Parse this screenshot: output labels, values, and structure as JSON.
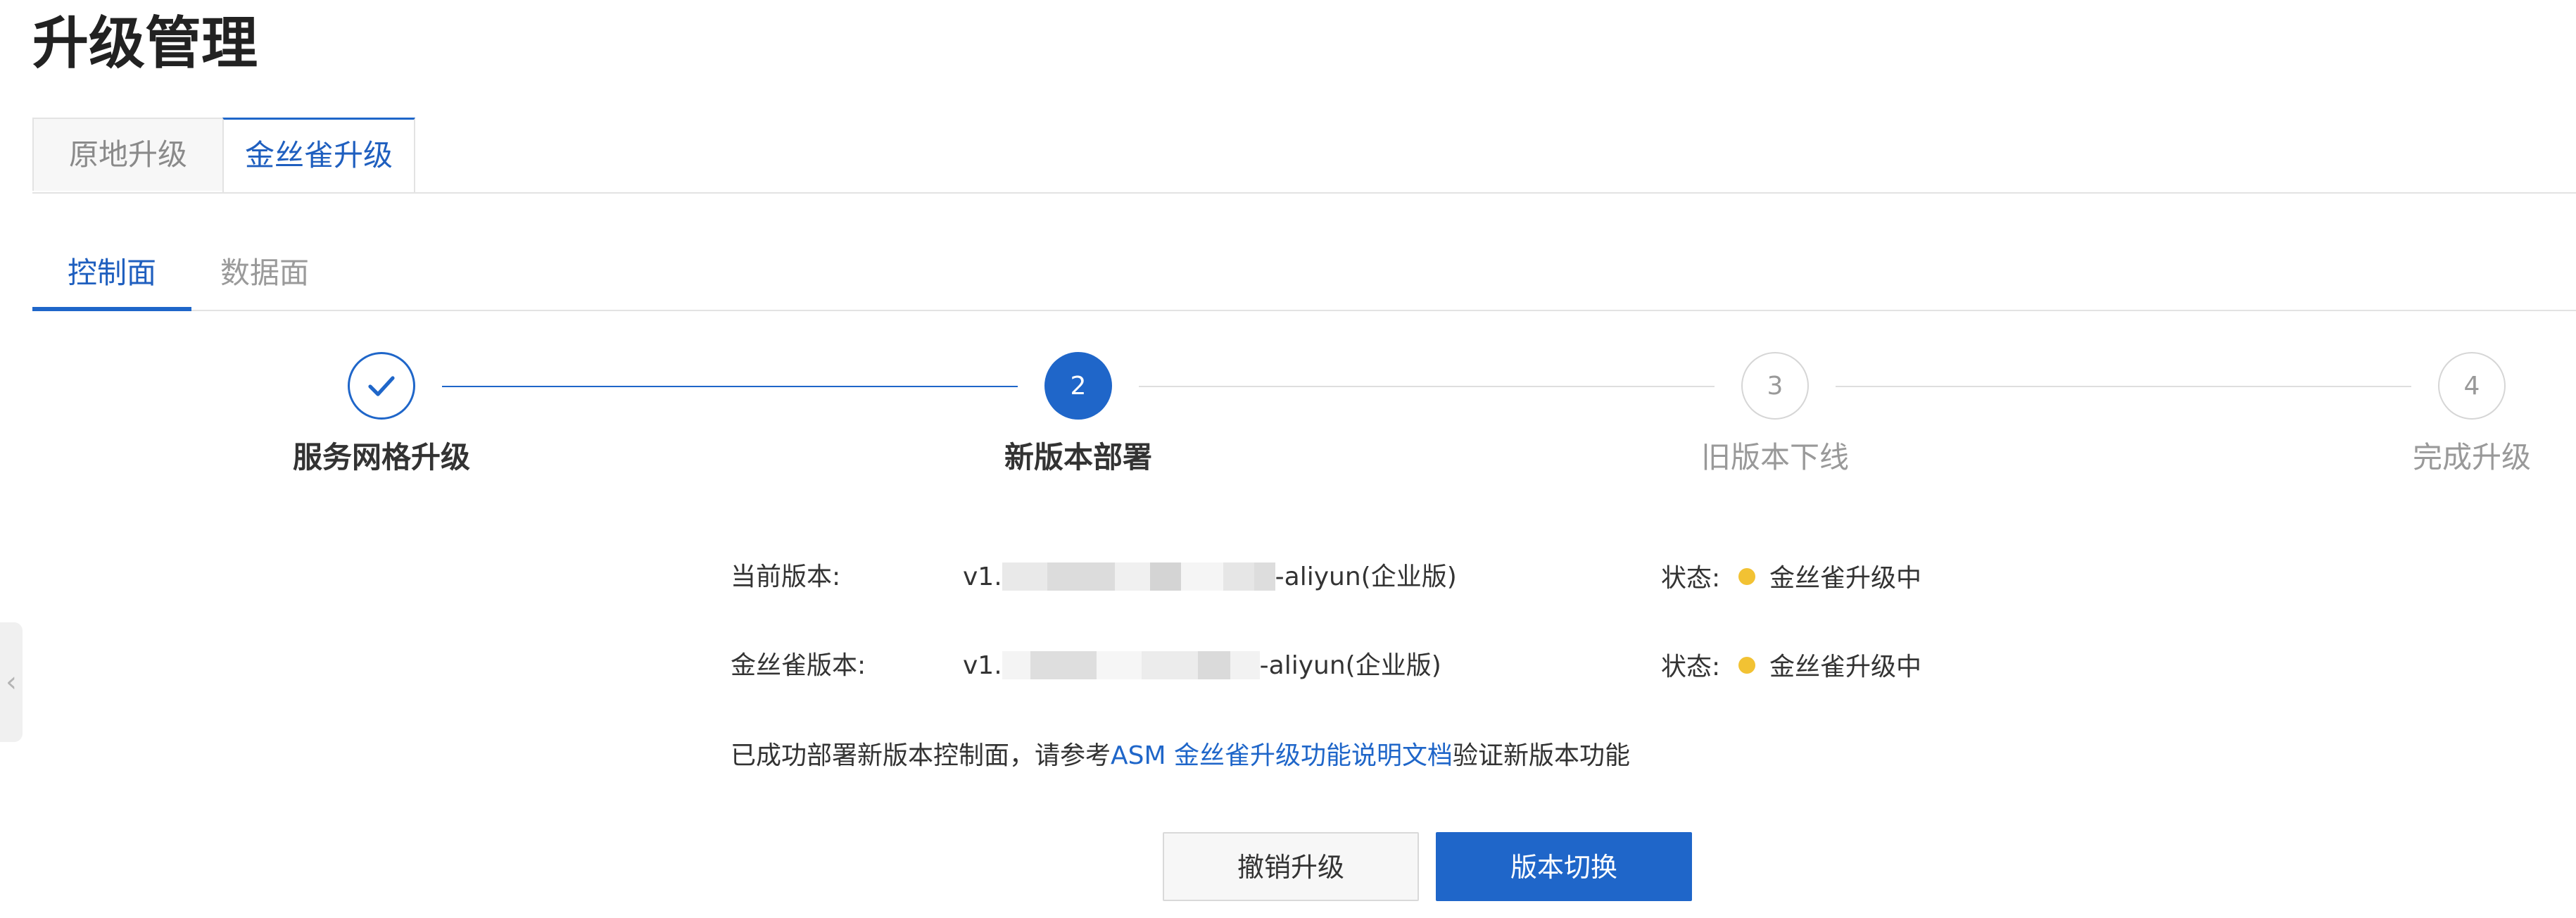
{
  "page": {
    "title": "升级管理"
  },
  "top_tabs": [
    {
      "label": "原地升级",
      "active": false
    },
    {
      "label": "金丝雀升级",
      "active": true
    }
  ],
  "sub_tabs": [
    {
      "label": "控制面",
      "active": true
    },
    {
      "label": "数据面",
      "active": false
    }
  ],
  "steps": [
    {
      "number": "",
      "label": "服务网格升级",
      "state": "done",
      "icon": "check-icon"
    },
    {
      "number": "2",
      "label": "新版本部署",
      "state": "active"
    },
    {
      "number": "3",
      "label": "旧版本下线",
      "state": "pending"
    },
    {
      "number": "4",
      "label": "完成升级",
      "state": "pending"
    }
  ],
  "info": {
    "current_version": {
      "label": "当前版本:",
      "value_prefix": "v1.",
      "value_suffix": "-aliyun(企业版)",
      "status_label": "状态:",
      "status_text": "金丝雀升级中"
    },
    "canary_version": {
      "label": "金丝雀版本:",
      "value_prefix": "v1.",
      "value_suffix": "-aliyun(企业版)",
      "status_label": "状态:",
      "status_text": "金丝雀升级中"
    },
    "message": {
      "before": "已成功部署新版本控制面，请参考",
      "link": "ASM 金丝雀升级功能说明文档",
      "after": "验证新版本功能"
    }
  },
  "buttons": {
    "cancel": "撤销升级",
    "switch": "版本切换"
  },
  "colors": {
    "primary": "#1f66c9",
    "status_dot": "#f2c233",
    "border": "#e3e3e3"
  }
}
